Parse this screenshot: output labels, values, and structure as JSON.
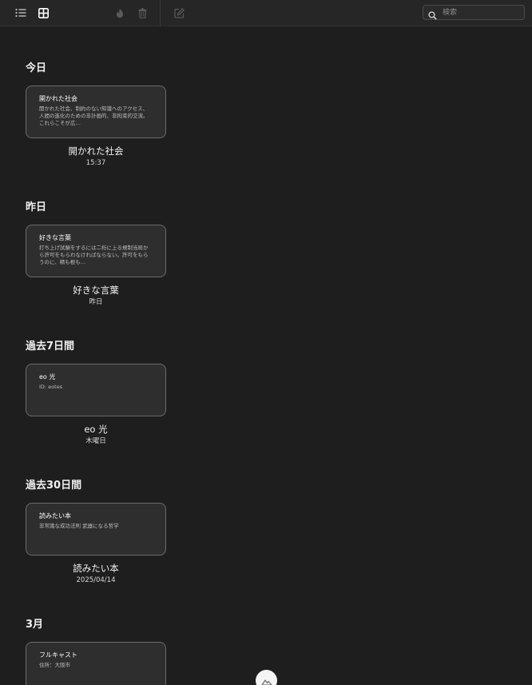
{
  "toolbar": {
    "list_view_icon": "list-icon",
    "grid_view_icon": "grid-icon",
    "lock_icon": "flame-icon",
    "trash_icon": "trash-icon",
    "compose_icon": "compose-icon",
    "search": {
      "placeholder": "検索",
      "value": ""
    }
  },
  "sections": [
    {
      "heading": "今日",
      "note": {
        "title": "開かれた社会",
        "preview": "開かれた社会、制約のない知識へのアクセス、人間の進化のための非計画的、非拘束的交流。これらこそが広…",
        "caption_title": "開かれた社会",
        "caption_date": "15:37"
      }
    },
    {
      "heading": "昨日",
      "note": {
        "title": "好きな言葉",
        "preview": "打ち上げ試験をするには二桁に上る規制当局から許可をもらわなければならない。許可をもらうのに、精も根も…",
        "caption_title": "好きな言葉",
        "caption_date": "昨日"
      }
    },
    {
      "heading": "過去7日間",
      "note": {
        "title": "eo 光",
        "preview": "ID: eotes",
        "caption_title": "eo 光",
        "caption_date": "木曜日"
      }
    },
    {
      "heading": "過去30日間",
      "note": {
        "title": "読みたい本",
        "preview": "非常識な成功法則 武器になる哲学",
        "caption_title": "読みたい本",
        "caption_date": "2025/04/14"
      }
    },
    {
      "heading": "3月",
      "note": {
        "title": "フルキャスト",
        "preview": "住所：大阪市",
        "caption_title": "",
        "caption_date": ""
      }
    }
  ],
  "colors": {
    "background": "#1e1e1e",
    "toolbar": "#262626",
    "card": "#2e2e2e",
    "card_border": "#6b6b6b",
    "disabled_icon": "#5a5a5a"
  }
}
